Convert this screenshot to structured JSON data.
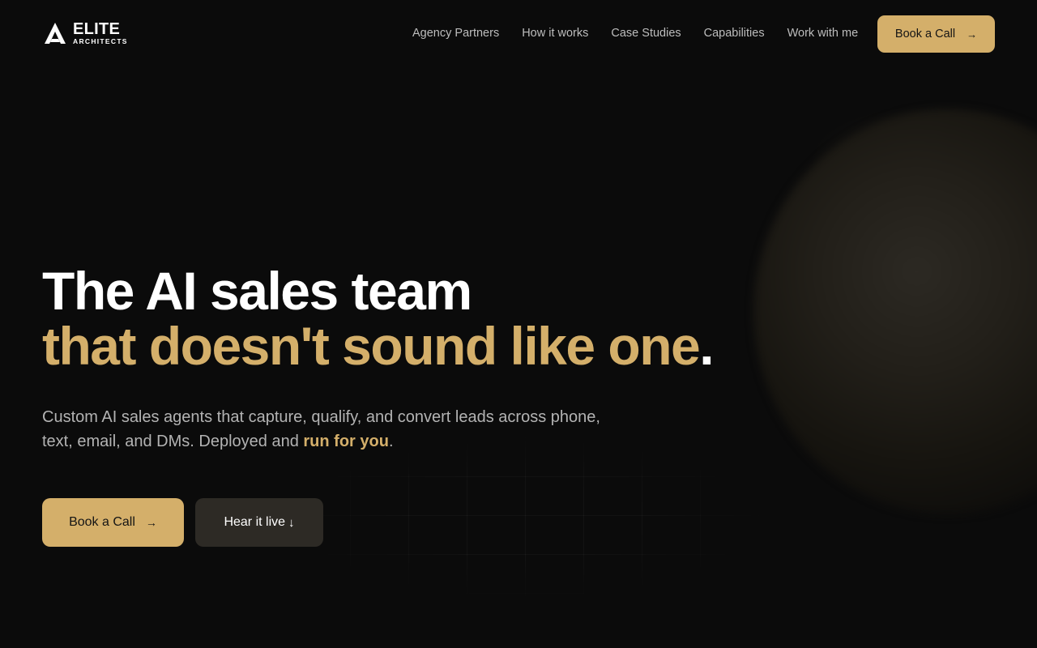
{
  "brand": {
    "name_primary": "ELITE",
    "name_secondary": "ARCHITECTS",
    "logo_icon": "triangle-a-logo-icon"
  },
  "nav": {
    "items": [
      {
        "label": "Agency Partners"
      },
      {
        "label": "How it works"
      },
      {
        "label": "Case Studies"
      },
      {
        "label": "Capabilities"
      },
      {
        "label": "Work with me"
      }
    ],
    "cta_label": "Book a Call",
    "cta_icon": "→"
  },
  "hero": {
    "title_line1": "The AI sales team",
    "title_line2": "that doesn't sound like one",
    "title_punct": ".",
    "subtitle_text": "Custom AI sales agents that capture, qualify, and convert leads across phone, text, email, and DMs. Deployed and ",
    "subtitle_highlight": "run for you",
    "subtitle_end": ".",
    "primary_button": "Book a Call",
    "primary_icon": "→",
    "secondary_button": "Hear it live",
    "secondary_icon": "↓"
  },
  "colors": {
    "background": "#0b0b0b",
    "accent_gold": "#d4af6a",
    "secondary_button_bg": "#2d2a25",
    "text_primary": "#ffffff",
    "text_muted": "#b3b3b3"
  }
}
